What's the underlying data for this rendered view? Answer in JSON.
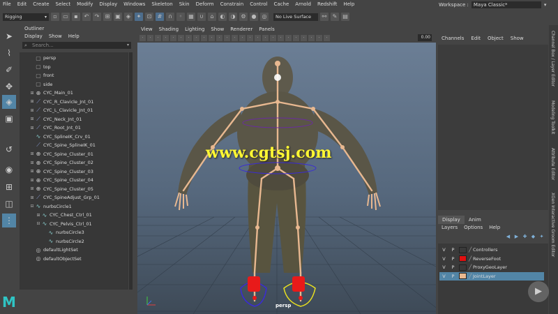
{
  "menubar": {
    "items": [
      "File",
      "Edit",
      "Create",
      "Select",
      "Modify",
      "Display",
      "Windows",
      "Skeleton",
      "Skin",
      "Deform",
      "Constrain",
      "Control",
      "Cache",
      "Arnold",
      "Redshift",
      "Help"
    ]
  },
  "workspace": {
    "label": "Workspace :",
    "value": "Maya Classic*"
  },
  "shelf": {
    "mode": "Rigging",
    "live_surface": "No Live Surface"
  },
  "outliner": {
    "title": "Outliner",
    "menu": [
      "Display",
      "Show",
      "Help"
    ],
    "search_placeholder": "Search...",
    "items": [
      {
        "label": "persp",
        "icon": "camera-icon",
        "expand": false,
        "depth": 0
      },
      {
        "label": "top",
        "icon": "camera-icon",
        "expand": false,
        "depth": 0
      },
      {
        "label": "front",
        "icon": "camera-icon",
        "expand": false,
        "depth": 0
      },
      {
        "label": "side",
        "icon": "camera-icon",
        "expand": false,
        "depth": 0
      },
      {
        "label": "CYC_Main_01",
        "icon": "cluster-icon",
        "expand": true,
        "depth": 0
      },
      {
        "label": "CYC_R_Clavicle_Jnt_01",
        "icon": "joint-icon",
        "expand": true,
        "depth": 0
      },
      {
        "label": "CYC_L_Clavicle_Jnt_01",
        "icon": "joint-icon",
        "expand": true,
        "depth": 0
      },
      {
        "label": "CYC_Neck_Jnt_01",
        "icon": "joint-icon",
        "expand": true,
        "depth": 0
      },
      {
        "label": "CYC_Root_Jnt_01",
        "icon": "joint-icon",
        "expand": true,
        "depth": 0
      },
      {
        "label": "CYC_SplineIK_Crv_01",
        "icon": "curve-icon",
        "expand": false,
        "depth": 0
      },
      {
        "label": "CYC_Spine_SplineIK_01",
        "icon": "joint-icon",
        "expand": false,
        "depth": 0
      },
      {
        "label": "CYC_Spine_Cluster_01",
        "icon": "cluster-icon",
        "expand": true,
        "depth": 0
      },
      {
        "label": "CYC_Spine_Cluster_02",
        "icon": "cluster-icon",
        "expand": true,
        "depth": 0
      },
      {
        "label": "CYC_Spine_Cluster_03",
        "icon": "cluster-icon",
        "expand": true,
        "depth": 0
      },
      {
        "label": "CYC_Spine_Cluster_04",
        "icon": "cluster-icon",
        "expand": true,
        "depth": 0
      },
      {
        "label": "CYC_Spine_Cluster_05",
        "icon": "cluster-icon",
        "expand": true,
        "depth": 0
      },
      {
        "label": "CYC_SpineAdjust_Grp_01",
        "icon": "joint-icon",
        "expand": true,
        "depth": 0
      },
      {
        "label": "nurbsCircle1",
        "icon": "curve-icon",
        "expand": "open",
        "depth": 0
      },
      {
        "label": "CYC_Chest_Ctrl_01",
        "icon": "curve-icon",
        "expand": true,
        "depth": 1
      },
      {
        "label": "CYC_Pelvis_Ctrl_01",
        "icon": "curve-icon",
        "expand": "open",
        "depth": 1
      },
      {
        "label": "nurbsCircle3",
        "icon": "curve-icon",
        "expand": false,
        "depth": 2
      },
      {
        "label": "nurbsCircle2",
        "icon": "curve-icon",
        "expand": false,
        "depth": 2
      },
      {
        "label": "defaultLightSet",
        "icon": "light-icon",
        "expand": false,
        "depth": 0
      },
      {
        "label": "defaultObjectSet",
        "icon": "light-icon",
        "expand": false,
        "depth": 0
      }
    ]
  },
  "viewport": {
    "menu": [
      "View",
      "Shading",
      "Lighting",
      "Show",
      "Renderer",
      "Panels"
    ],
    "zoom": "0.00",
    "camera": "persp",
    "watermark": "www.cgtsj.com"
  },
  "channel_box": {
    "tabs": [
      "Channels",
      "Edit",
      "Object",
      "Show"
    ]
  },
  "layers": {
    "tabs": [
      "Display",
      "Anim"
    ],
    "menu": [
      "Layers",
      "Options",
      "Help"
    ],
    "items": [
      {
        "v": "V",
        "p": "P",
        "name": "Controllers",
        "color": "",
        "selected": false
      },
      {
        "v": "V",
        "p": "P",
        "name": "ReverseFoot",
        "color": "#e01010",
        "selected": false
      },
      {
        "v": "V",
        "p": "P",
        "name": "ProxyGeoLayer",
        "color": "",
        "selected": false
      },
      {
        "v": "V",
        "p": "P",
        "name": "JointLayer",
        "color": "#e8b890",
        "selected": true
      }
    ]
  },
  "side_tabs": [
    "Channel Box / Layer Editor",
    "Modeling Toolkit",
    "Attribute Editor",
    "XGen Interactive Groom Editor"
  ],
  "colors": {
    "accent": "#5285a6",
    "maya_logo": "#2fc4c4"
  }
}
